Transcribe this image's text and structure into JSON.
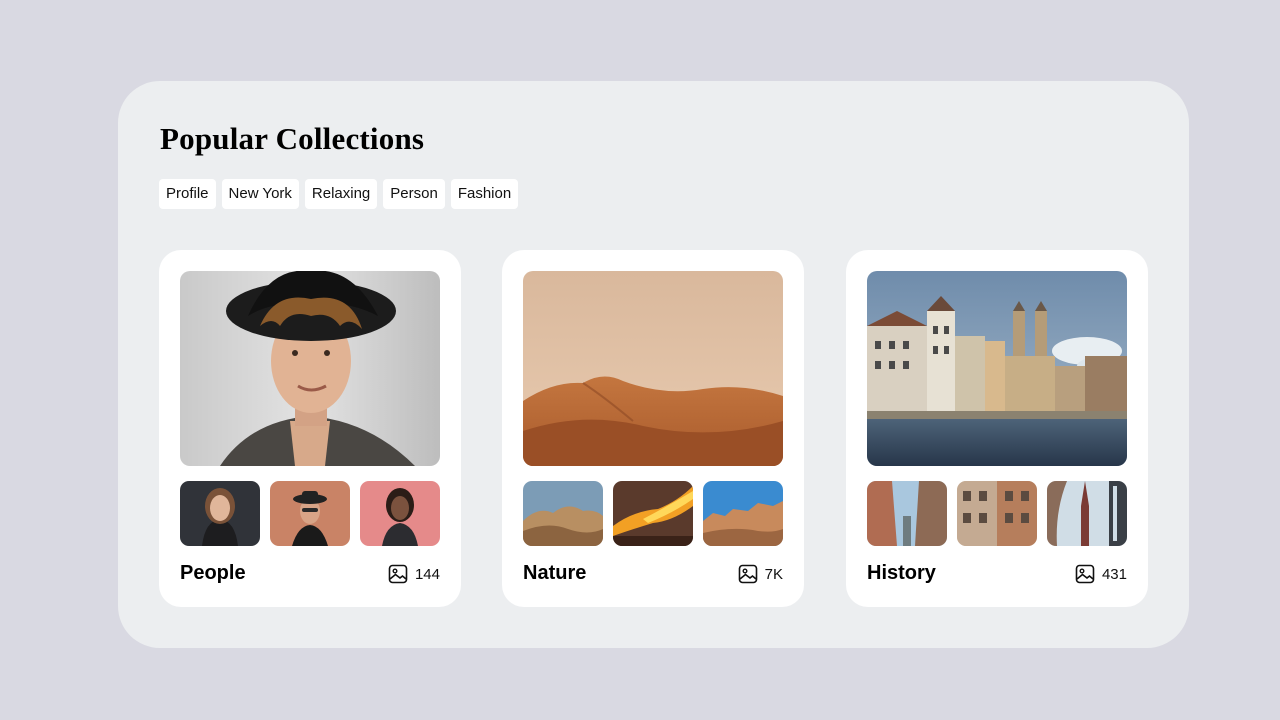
{
  "page": {
    "title": "Popular Collections"
  },
  "tags": [
    "Profile",
    "New York",
    "Relaxing",
    "Person",
    "Fashion"
  ],
  "collections": [
    {
      "name": "People",
      "count": "144",
      "hero_icon": "man-with-hat-photo",
      "thumb_icons": [
        "woman-portrait-photo",
        "man-with-hat-sunglasses-photo",
        "woman-pink-background-photo"
      ]
    },
    {
      "name": "Nature",
      "count": "7K",
      "hero_icon": "desert-dunes-photo",
      "thumb_icons": [
        "rock-formation-photo",
        "sunset-clouds-photo",
        "canyon-photo"
      ]
    },
    {
      "name": "History",
      "count": "431",
      "hero_icon": "city-river-photo",
      "thumb_icons": [
        "street-buildings-photo",
        "building-facade-photo",
        "church-spire-photo"
      ]
    }
  ],
  "colors": {
    "page_background": "#d9d9e2",
    "panel_background": "#eceef0",
    "card_background": "#ffffff"
  },
  "icons": {
    "count": "image-icon"
  }
}
